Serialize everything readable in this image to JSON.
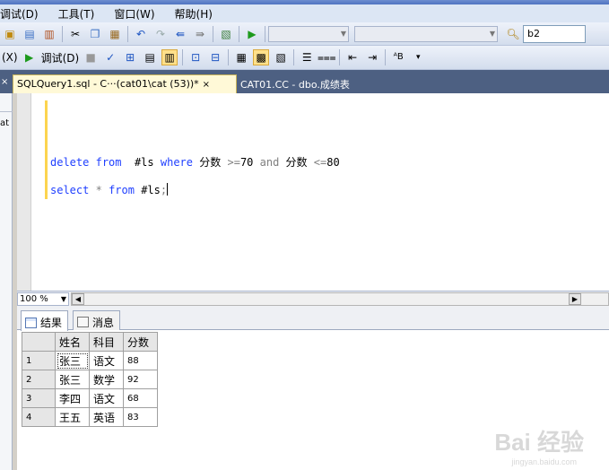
{
  "menu": [
    "调试(D)",
    "工具(T)",
    "窗口(W)",
    "帮助(H)"
  ],
  "toolbar": {
    "search_value": "b2"
  },
  "toolbar2": {
    "left_label": "(X)",
    "debug_label": "调试(D)"
  },
  "tabs": {
    "active": "SQLQuery1.sql - C···(cat01\\cat (53))*",
    "inactive": "CAT01.CC - dbo.成绩表",
    "close_glyph": "×"
  },
  "left_pane": {
    "text": "at",
    "tab_close": "×"
  },
  "editor": {
    "line1": {
      "kw1": "delete",
      "kw2": "from",
      "t1": "#ls",
      "kw3": "where",
      "t2": "分数",
      "op1": ">=",
      "t3": "70",
      "kw4": "and",
      "t4": "分数",
      "op2": "<=",
      "t5": "80"
    },
    "line2": {
      "kw1": "select",
      "op1": "*",
      "kw2": "from",
      "t1": "#ls",
      "op2": ";"
    }
  },
  "zoom": "100 %",
  "results": {
    "tab_results": "结果",
    "tab_messages": "消息",
    "columns": [
      "姓名",
      "科目",
      "分数"
    ],
    "rows": [
      {
        "num": "1",
        "name": "张三",
        "subject": "语文",
        "score": "88"
      },
      {
        "num": "2",
        "name": "张三",
        "subject": "数学",
        "score": "92"
      },
      {
        "num": "3",
        "name": "李四",
        "subject": "语文",
        "score": "68"
      },
      {
        "num": "4",
        "name": "王五",
        "subject": "英语",
        "score": "83"
      }
    ]
  },
  "watermark": {
    "main": "Bai 经验",
    "sub": "jingyan.baidu.com"
  },
  "colors": {
    "keyword": "#1f3fff",
    "tab_strip": "#4d6082",
    "active_tab": "#fff9d7"
  }
}
